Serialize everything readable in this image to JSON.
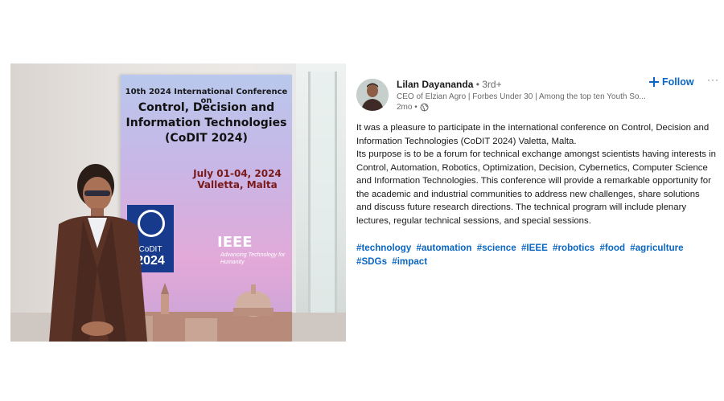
{
  "banner": {
    "line1": "10th 2024 International Conference on",
    "line2": "Control, Decision and Information Technologies (CoDIT 2024)",
    "dates": "July 01-04, 2024",
    "place": "Valletta, Malta",
    "logo_small": "CoDIT",
    "logo_year": "2024",
    "ieee": "IEEE",
    "ieee_tagline": "Advancing Technology for Humanity"
  },
  "post": {
    "author_name": "Lilan Dayananda",
    "degree": " • 3rd+",
    "headline": "CEO of Elzian Agro | Forbes Under 30 | Among the top ten Youth So...",
    "time": "2mo •",
    "visibility_icon": "globe-icon",
    "follow_label": "Follow",
    "more_label": "···",
    "paragraph1": "It was a pleasure to participate in the international conference on Control, Decision and Information Technologies (CoDIT 2024) Valetta, Malta.",
    "paragraph2": "Its purpose is to be a forum for technical exchange amongst scientists having interests in Control, Automation, Robotics, Optimization, Decision, Cybernetics, Computer Science and Information Technologies. This conference will provide a remarkable opportunity for the academic and industrial communities to address new challenges, share solutions and discuss future research directions. The technical program will include plenary lectures, regular technical sessions, and special sessions.",
    "hashtags": [
      "#technology",
      "#automation",
      "#science",
      "#IEEE",
      "#robotics",
      "#food",
      "#agriculture",
      "#SDGs",
      "#impact"
    ]
  },
  "colors": {
    "link_blue": "#0a66c2",
    "banner_navy": "#173a8c"
  }
}
